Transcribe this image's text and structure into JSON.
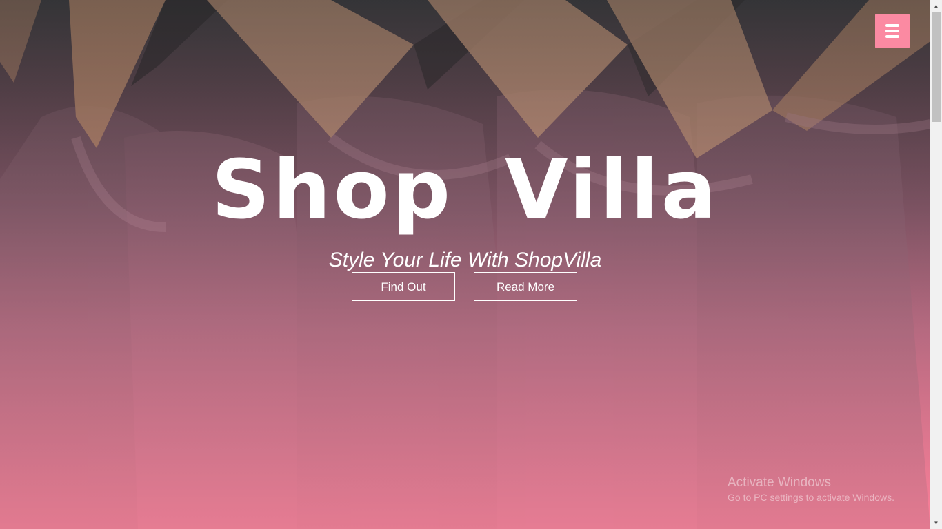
{
  "hero": {
    "background_description_icon": "clothes-hanger-image",
    "title": "Shop Villa",
    "tagline": "Style Your Life With ShopVilla",
    "buttons": {
      "find_out": "Find Out",
      "read_more": "Read More"
    }
  },
  "nav": {
    "menu_icon": "hamburger-menu-icon"
  },
  "watermark": {
    "title": "Activate Windows",
    "subtitle": "Go to PC settings to activate Windows."
  },
  "colors": {
    "accent": "#fb8aa2",
    "text": "#ffffff",
    "gradient_top": "#3b3b3d",
    "gradient_bottom": "#fb8099"
  }
}
